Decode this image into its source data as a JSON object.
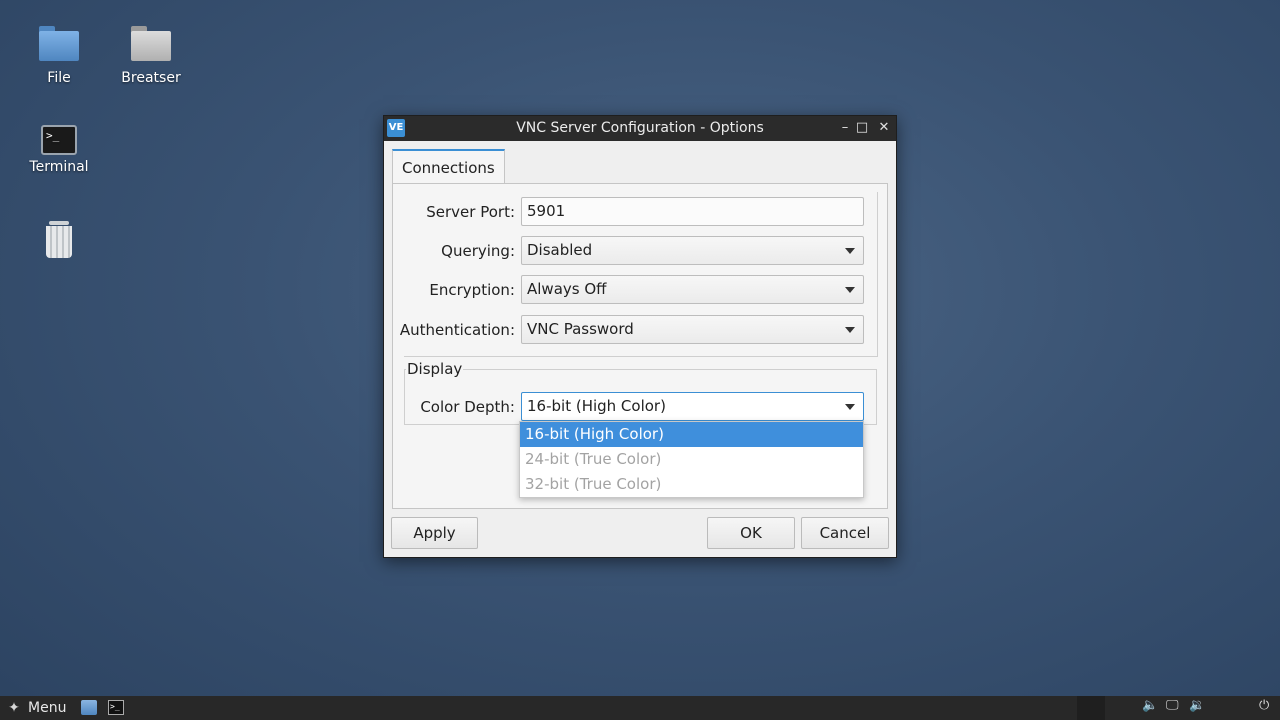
{
  "desktop": {
    "icons": [
      {
        "label": "File",
        "icon": "folder-icon"
      },
      {
        "label": "Breatser",
        "icon": "folder-icon"
      },
      {
        "label": "Terminal",
        "icon": "terminal-icon"
      },
      {
        "label": "",
        "icon": "trash-icon"
      }
    ]
  },
  "window": {
    "app_icon_text": "VE",
    "title": "VNC Server Configuration - Options",
    "controls": {
      "minimize": "–",
      "maximize": "□",
      "close": "✕"
    }
  },
  "tabs": [
    {
      "label": "Connections"
    }
  ],
  "form": {
    "server_port": {
      "label": "Server Port:",
      "value": "5901"
    },
    "querying": {
      "label": "Querying:",
      "value": "Disabled"
    },
    "encryption": {
      "label": "Encryption:",
      "value": "Always Off"
    },
    "authentication": {
      "label": "Authentication:",
      "value": "VNC Password"
    }
  },
  "display": {
    "legend": "Display",
    "color_depth": {
      "label": "Color Depth:",
      "value": "16-bit (High Color)",
      "options": [
        "16-bit (High Color)",
        "24-bit (True Color)",
        "32-bit (True Color)"
      ]
    }
  },
  "buttons": {
    "apply": "Apply",
    "ok": "OK",
    "cancel": "Cancel"
  },
  "taskbar": {
    "menu_label": "Menu",
    "terminal_glyph": ">_"
  },
  "colors": {
    "accent": "#3f8fdc",
    "titlebar": "#2b2b2b",
    "taskbar": "#282828"
  }
}
